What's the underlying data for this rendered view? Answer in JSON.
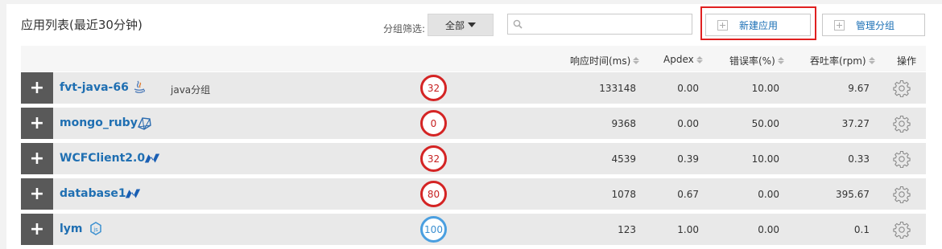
{
  "header": {
    "title": "应用列表(最近30分钟)",
    "filter_label": "分组筛选:",
    "filter_value": "全部",
    "search_placeholder": "",
    "new_app_label": "新建应用",
    "manage_groups_label": "管理分组"
  },
  "columns": {
    "response_time": "响应时间(ms)",
    "apdex": "Apdex",
    "error_rate": "错误率(%)",
    "throughput": "吞吐率(rpm)",
    "actions": "操作"
  },
  "rows": [
    {
      "name": "fvt-java-66",
      "icon": "java-icon",
      "group": "java分组",
      "alerts": "32",
      "alert_color": "#d42424",
      "response_time": "133148",
      "apdex": "0.00",
      "error_rate": "10.00",
      "throughput": "9.67"
    },
    {
      "name": "mongo_ruby",
      "icon": "ruby-icon",
      "group": "",
      "alerts": "0",
      "alert_color": "#d42424",
      "response_time": "9368",
      "apdex": "0.00",
      "error_rate": "50.00",
      "throughput": "37.27"
    },
    {
      "name": "WCFClient2.0",
      "icon": "dotnet-icon",
      "group": "",
      "alerts": "32",
      "alert_color": "#d42424",
      "response_time": "4539",
      "apdex": "0.39",
      "error_rate": "10.00",
      "throughput": "0.33"
    },
    {
      "name": "database1",
      "icon": "dotnet-icon",
      "group": "",
      "alerts": "80",
      "alert_color": "#d42424",
      "response_time": "1078",
      "apdex": "0.67",
      "error_rate": "0.00",
      "throughput": "395.67"
    },
    {
      "name": "lym",
      "icon": "nodejs-icon",
      "group": "",
      "alerts": "100",
      "alert_color": "#4a9fe0",
      "response_time": "123",
      "apdex": "1.00",
      "error_rate": "0.00",
      "throughput": "0.1"
    }
  ]
}
